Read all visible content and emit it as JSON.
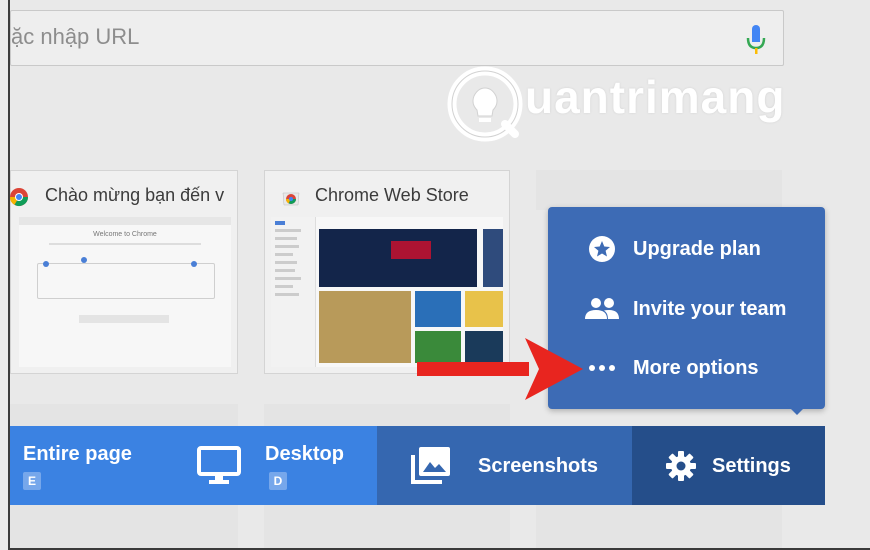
{
  "search": {
    "placeholder_text": "ặc nhập URL"
  },
  "watermark": {
    "text": "uantrimang"
  },
  "tiles": [
    {
      "title": "Chào mừng bạn đến v",
      "thumb_heading": "Welcome to Chrome"
    },
    {
      "title": "Chrome Web Store"
    }
  ],
  "menu": {
    "items": [
      {
        "label": "Upgrade plan",
        "icon": "star-circle-icon"
      },
      {
        "label": "Invite your team",
        "icon": "people-icon"
      },
      {
        "label": "More options",
        "icon": "more-horizontal-icon"
      }
    ]
  },
  "toolbar": {
    "entire_page": {
      "label": "Entire page",
      "shortcut": "E"
    },
    "desktop": {
      "label": "Desktop",
      "shortcut": "D"
    },
    "screenshots": {
      "label": "Screenshots"
    },
    "settings": {
      "label": "Settings"
    }
  },
  "colors": {
    "menu_bg": "#3d6bb5",
    "toolbar_primary": "#3b82e2",
    "toolbar_screens": "#3567b0",
    "toolbar_settings": "#254e8a",
    "annotation_arrow": "#e8251f"
  }
}
